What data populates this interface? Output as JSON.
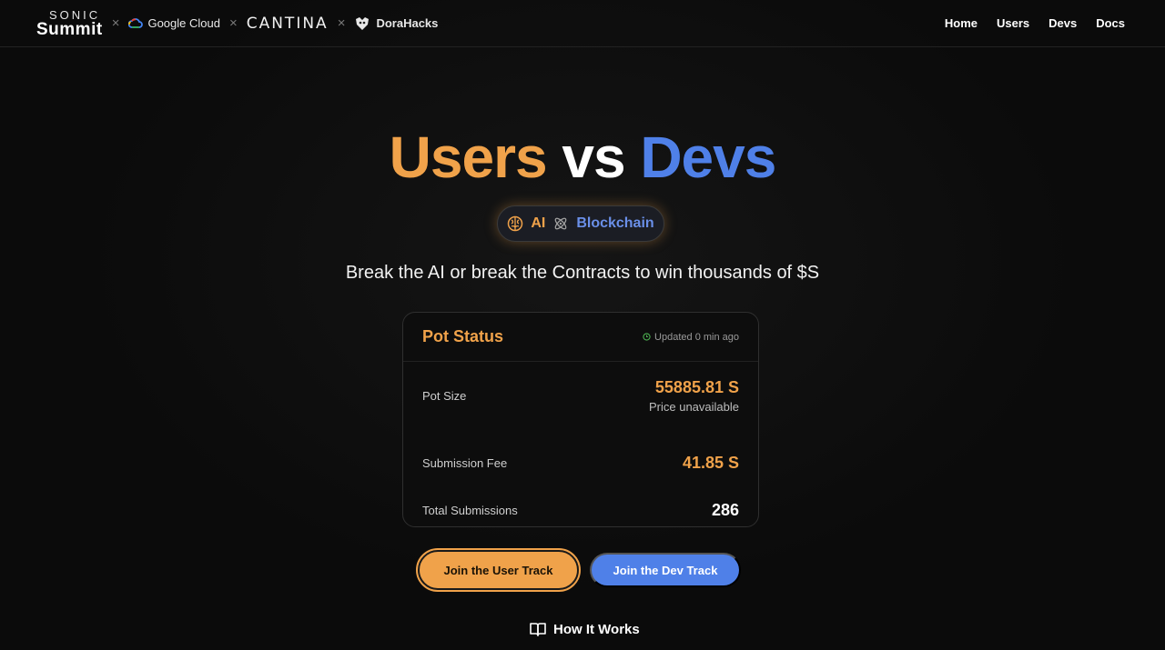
{
  "header": {
    "logos": {
      "sonic_top": "SONIC",
      "sonic_bottom": "Summit",
      "separator": "×",
      "google_cloud": "Google Cloud",
      "cantina": "CANTINA",
      "dorahacks": "DoraHacks"
    },
    "nav": [
      {
        "label": "Home"
      },
      {
        "label": "Users"
      },
      {
        "label": "Devs"
      },
      {
        "label": "Docs"
      }
    ]
  },
  "hero": {
    "title_users": "Users",
    "title_vs": "vs",
    "title_devs": "Devs",
    "pill_ai": "AI",
    "pill_blockchain": "Blockchain",
    "tagline": "Break the AI or break the Contracts to win thousands of $S"
  },
  "pot": {
    "title": "Pot Status",
    "updated": "Updated 0 min ago",
    "rows": {
      "pot_size_label": "Pot Size",
      "pot_size_value": "55885.81 S",
      "pot_size_sub": "Price unavailable",
      "fee_label": "Submission Fee",
      "fee_value": "41.85 S",
      "subs_label": "Total Submissions",
      "subs_value": "286"
    }
  },
  "actions": {
    "user_track": "Join the User Track",
    "dev_track": "Join the Dev Track",
    "how_it_works": "How It Works"
  },
  "colors": {
    "orange": "#f0a24a",
    "blue": "#4f80e8",
    "background": "#0b0b0b"
  },
  "icons": {
    "brain": "brain-icon",
    "atom": "atom-icon",
    "clock": "clock-icon",
    "book": "book-icon",
    "google_cloud": "google-cloud-icon",
    "dorahacks": "dorahacks-icon"
  }
}
